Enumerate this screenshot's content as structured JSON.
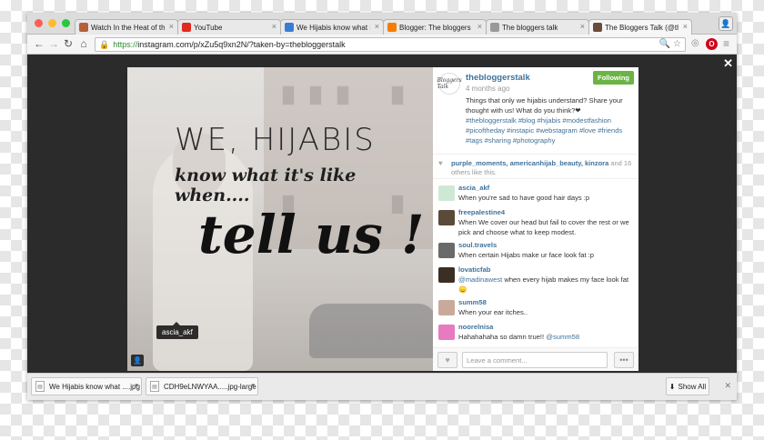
{
  "browser": {
    "tabs": [
      {
        "label": "Watch In the Heat of the",
        "icon": "film-icon",
        "color": "#b3603a",
        "active": false
      },
      {
        "label": "YouTube",
        "icon": "youtube-icon",
        "color": "#e02a20",
        "active": false
      },
      {
        "label": "We Hijabis know what it",
        "icon": "doc-icon",
        "color": "#3b7bd4",
        "active": false
      },
      {
        "label": "Blogger: The bloggers ta",
        "icon": "blogger-icon",
        "color": "#f57d00",
        "active": false
      },
      {
        "label": "The bloggers talk",
        "icon": "page-icon",
        "color": "#999999",
        "active": false
      },
      {
        "label": "The Bloggers Talk (@thet",
        "icon": "instagram-icon",
        "color": "#6b4b3a",
        "active": true
      }
    ],
    "url_scheme": "https://",
    "url_rest": "instagram.com/p/xZu5q9xn2N/?taken-by=thebloggerstalk"
  },
  "post": {
    "close_symbol": "✕",
    "image_text": {
      "line1": "WE, HIJABIS",
      "line2": "know what it's like when....",
      "line3": "tell us !"
    },
    "tag_label": "ascia_akf",
    "username": "thebloggerstalk",
    "avatar_text": "Bloggers Talk",
    "follow_label": "Following",
    "time": "4 months ago",
    "caption_text": "Things that only we hijabis understand? Share your thought with us! What do you think?❤ ",
    "caption_tags": "#thebloggerstalk #blog #hijabis #modestfashion #picoftheday #instapic #webstagram #love #friends #tags #sharing #photography",
    "likes_names": "purple_moments, americanhijab_beauty, kinzora",
    "likes_tail": " and 16 others like this.",
    "comments": [
      {
        "user": "ascia_akf",
        "text": "When you're sad to have good hair days :p",
        "mention": "",
        "avatar_color": "#cfe8d6"
      },
      {
        "user": "freepalestine4",
        "text": "When We cover our head but fail to cover the rest or we pick and choose what to keep modest.",
        "mention": "",
        "avatar_color": "#5a4a3a"
      },
      {
        "user": "soul.travels",
        "text": "When certain Hijabs make ur face look fat :p",
        "mention": "",
        "avatar_color": "#6a6a6a"
      },
      {
        "user": "lovaticfab",
        "text": " when every hijab makes my face look fat 😞",
        "mention": "@madinawest",
        "avatar_color": "#3a2e25"
      },
      {
        "user": "summ58",
        "text": "When your ear itches..",
        "mention": "",
        "avatar_color": "#c9a99a"
      },
      {
        "user": "noorelnisa",
        "text": "Hahahahaha so damn true!! ",
        "mention": "@summ58",
        "avatar_color": "#e77ac0"
      }
    ],
    "comment_placeholder": "Leave a comment...",
    "more_label": "•••"
  },
  "downloads": {
    "items": [
      {
        "label": "We Hijabis know what ....jpg"
      },
      {
        "label": "CDH9eLNWYAA.....jpg-large"
      }
    ],
    "show_all_label": "Show All"
  }
}
